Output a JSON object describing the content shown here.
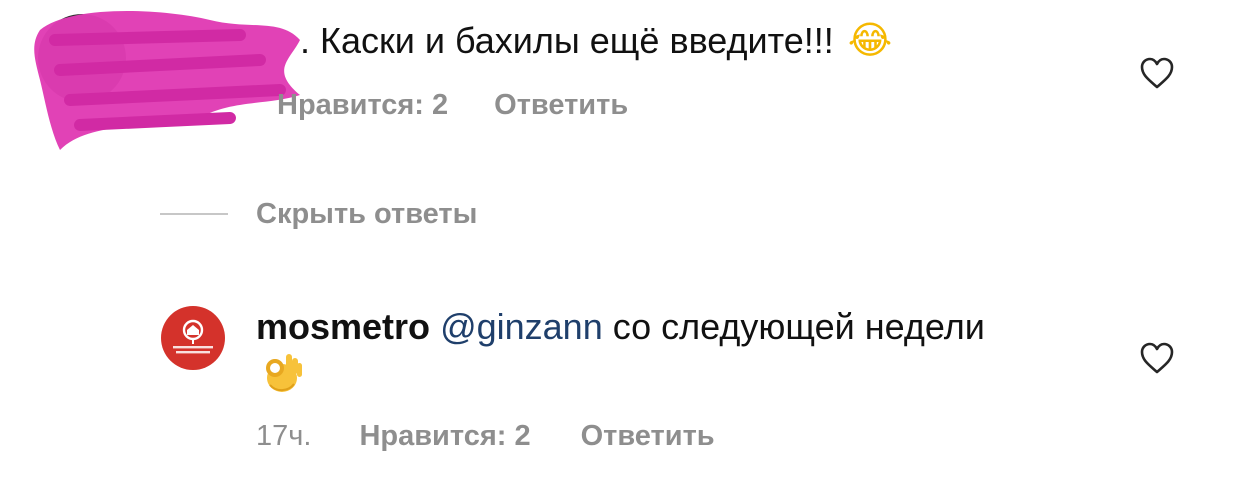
{
  "comment_1": {
    "text": ". Каски и бахилы ещё введите!!!",
    "emoji": "😂",
    "likes": "Нравится: 2",
    "reply": "Ответить"
  },
  "replies": {
    "hide_label": "Скрыть ответы"
  },
  "comment_2": {
    "username": "mosmetro",
    "mention": "@ginzann",
    "text": "со следующей недели",
    "emoji": "👌",
    "time": "17ч.",
    "likes": "Нравится: 2",
    "reply": "Ответить"
  },
  "colors": {
    "meta_gray": "#8e8e8e",
    "mention_blue": "#1f3f6b",
    "mosmetro_red": "#d4322b",
    "scribble_magenta": "#e03cb4"
  },
  "icons": {
    "like": "heart-outline-icon",
    "avatar_logo": "metro-pin-logo"
  }
}
